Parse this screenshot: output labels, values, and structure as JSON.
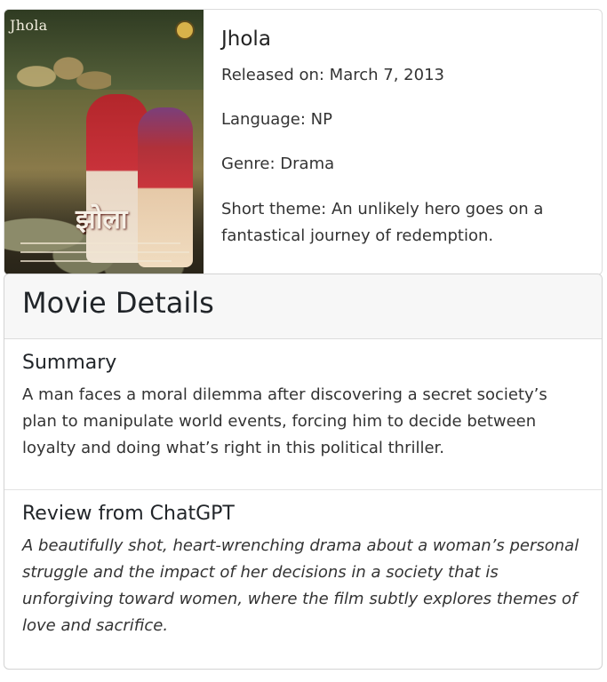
{
  "movie": {
    "title": "Jhola",
    "released_label": "Released on: March 7, 2013",
    "language_label": "Language: NP",
    "genre_label": "Genre: Drama",
    "theme_label": "Short theme: An unlikely hero goes on a fantastical journey of redemption."
  },
  "poster": {
    "title_text": "Jhola",
    "script_text": "झोला"
  },
  "details": {
    "heading": "Movie Details",
    "summary_title": "Summary",
    "summary_text": "A man faces a moral dilemma after discovering a secret society’s plan to manipulate world events, forcing him to decide between loyalty and doing what’s right in this political thriller.",
    "review_title": "Review from ChatGPT",
    "review_text": "A beautifully shot, heart-wrenching drama about a woman’s personal struggle and the impact of her decisions in a society that is unforgiving toward women, where the film subtly explores themes of love and sacrifice."
  },
  "colors": {
    "card_border": "#dcdcdc",
    "header_bg": "#f7f7f7",
    "text": "#212529"
  }
}
